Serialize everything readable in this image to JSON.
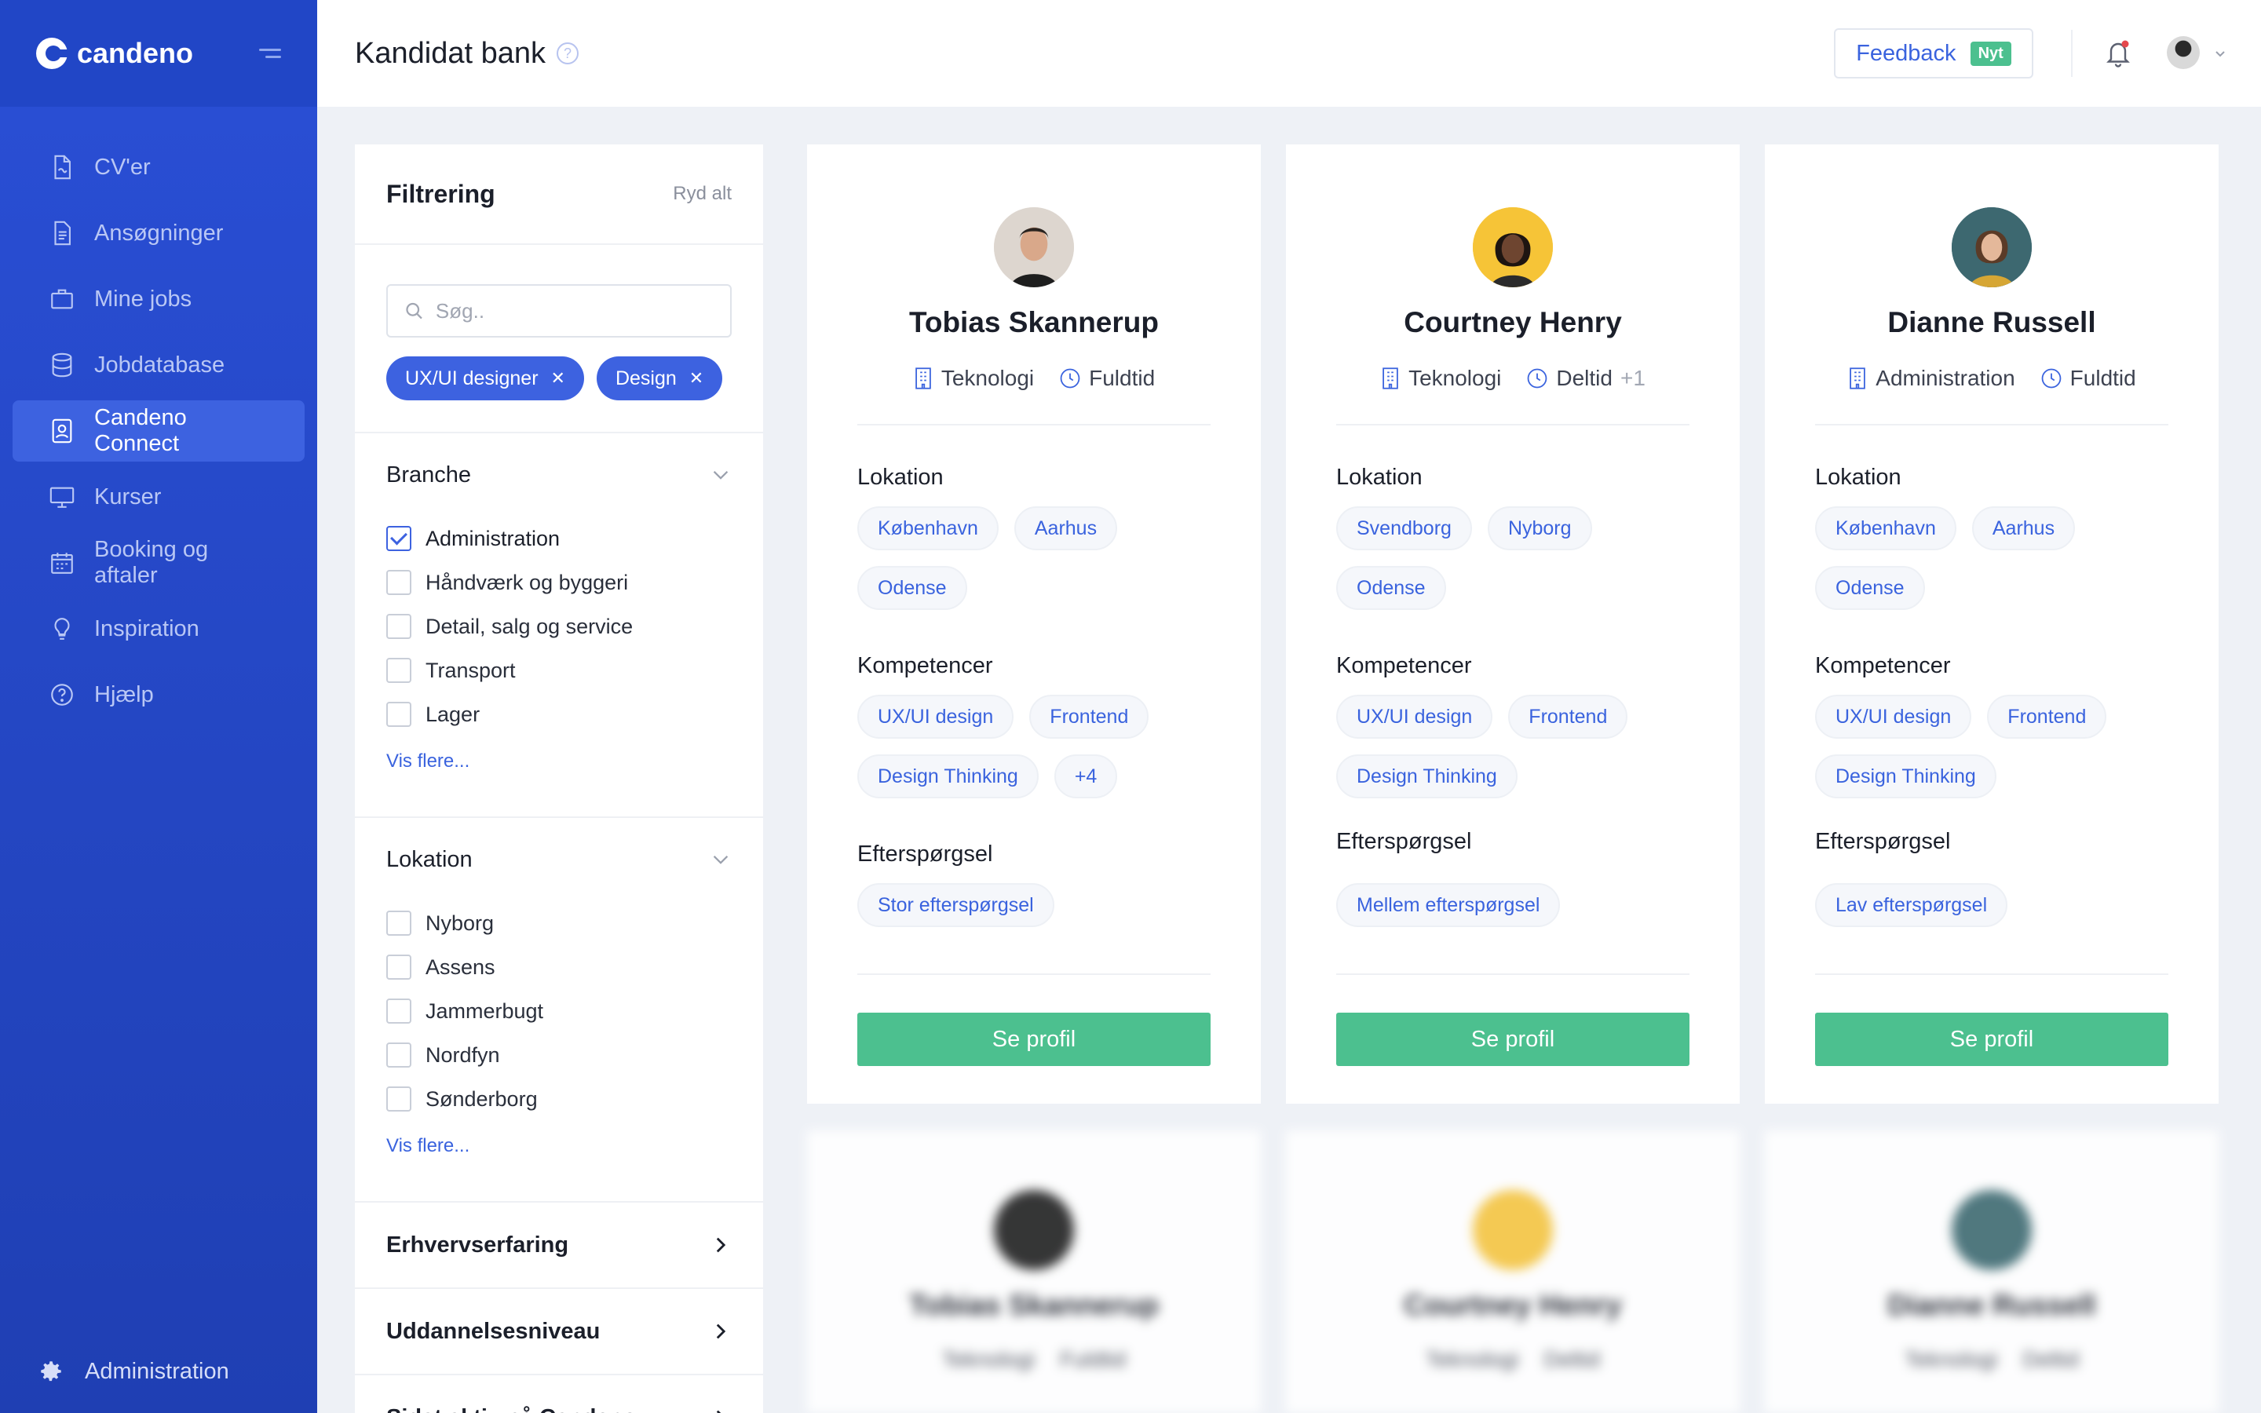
{
  "app": {
    "brand": "candeno"
  },
  "sidebar": {
    "items": [
      {
        "label": "CV'er",
        "icon": "document-icon"
      },
      {
        "label": "Ansøgninger",
        "icon": "file-text-icon"
      },
      {
        "label": "Mine jobs",
        "icon": "briefcase-icon"
      },
      {
        "label": "Jobdatabase",
        "icon": "database-icon"
      },
      {
        "label": "Candeno Connect",
        "icon": "person-badge-icon",
        "active": true
      },
      {
        "label": "Kurser",
        "icon": "monitor-icon"
      },
      {
        "label": "Booking og aftaler",
        "icon": "calendar-icon"
      },
      {
        "label": "Inspiration",
        "icon": "lightbulb-icon"
      },
      {
        "label": "Hjælp",
        "icon": "help-circle-icon"
      }
    ],
    "footer": {
      "label": "Administration",
      "icon": "gear-icon"
    }
  },
  "header": {
    "title": "Kandidat bank",
    "feedback_label": "Feedback",
    "feedback_badge": "Nyt"
  },
  "filter": {
    "title": "Filtrering",
    "clear": "Ryd alt",
    "search_placeholder": "Søg..",
    "chips": [
      "UX/UI designer",
      "Design"
    ],
    "branche": {
      "title": "Branche",
      "options": [
        {
          "label": "Administration",
          "checked": true
        },
        {
          "label": "Håndværk og byggeri",
          "checked": false
        },
        {
          "label": "Detail, salg og service",
          "checked": false
        },
        {
          "label": "Transport",
          "checked": false
        },
        {
          "label": "Lager",
          "checked": false
        }
      ],
      "more": "Vis flere..."
    },
    "lokation": {
      "title": "Lokation",
      "options": [
        {
          "label": "Nyborg",
          "checked": false
        },
        {
          "label": "Assens",
          "checked": false
        },
        {
          "label": "Jammerbugt",
          "checked": false
        },
        {
          "label": "Nordfyn",
          "checked": false
        },
        {
          "label": "Sønderborg",
          "checked": false
        }
      ],
      "more": "Vis flere..."
    },
    "collapsed": [
      "Erhvervserfaring",
      "Uddannelsesniveau",
      "Sidst aktiv på Candeno"
    ]
  },
  "labels": {
    "lokation": "Lokation",
    "kompetencer": "Kompetencer",
    "efterspoergsel": "Efterspørgsel",
    "button": "Se profil"
  },
  "candidates": [
    {
      "name": "Tobias Skannerup",
      "industry": "Teknologi",
      "hours": "Fuldtid",
      "hours_extra": "",
      "locations": [
        "København",
        "Aarhus",
        "Odense"
      ],
      "skills": [
        "UX/UI design",
        "Frontend",
        "Design Thinking",
        "+4"
      ],
      "demand": "Stor efterspørgsel"
    },
    {
      "name": "Courtney Henry",
      "industry": "Teknologi",
      "hours": "Deltid",
      "hours_extra": "+1",
      "locations": [
        "Svendborg",
        "Nyborg",
        "Odense"
      ],
      "skills": [
        "UX/UI design",
        "Frontend",
        "Design Thinking"
      ],
      "demand": "Mellem efterspørgsel"
    },
    {
      "name": "Dianne Russell",
      "industry": "Administration",
      "hours": "Fuldtid",
      "hours_extra": "",
      "locations": [
        "København",
        "Aarhus",
        "Odense"
      ],
      "skills": [
        "UX/UI design",
        "Frontend",
        "Design Thinking"
      ],
      "demand": "Lav efterspørgsel"
    }
  ],
  "colors": {
    "primary": "#2146c6",
    "accent": "#3d62e0",
    "success": "#4cc08f"
  }
}
